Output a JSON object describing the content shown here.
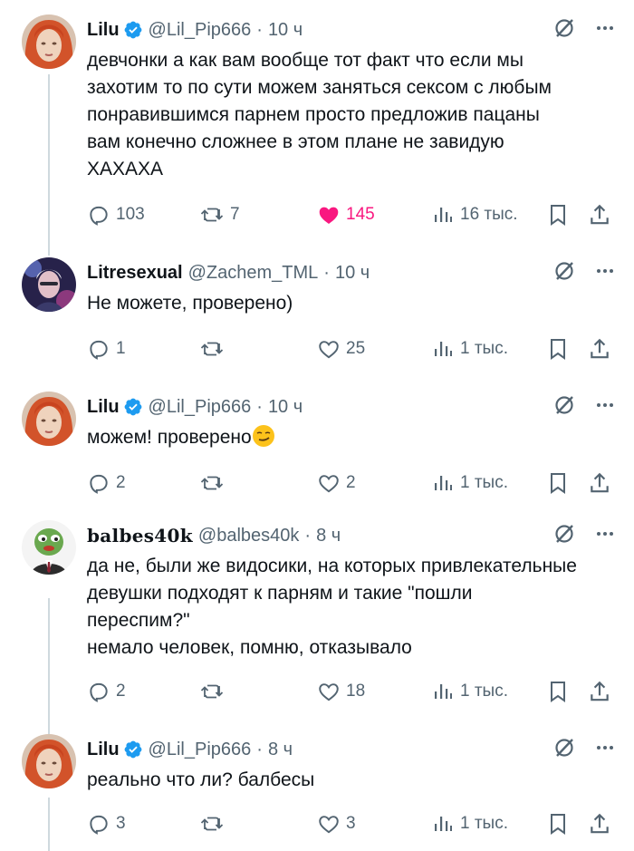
{
  "accent": {
    "like": "#f91880",
    "verified": "#1d9bf0",
    "muted": "#536471"
  },
  "posts": [
    {
      "name": "Lilu",
      "verified": true,
      "handle": "@Lil_Pip666",
      "time": "10 ч",
      "text": "девчонки а как вам вообще тот факт что если мы\nзахотим то по сути можем заняться сексом с любым\nпонравившимся парнем просто предложив пацаны\nвам конечно сложнее в этом плане не завидую\nХАХАХА",
      "replies": "103",
      "reposts": "7",
      "likes": "145",
      "views": "16 тыс."
    },
    {
      "name": "Litresexual",
      "verified": false,
      "handle": "@Zachem_TML",
      "time": "10 ч",
      "text": "Не можете, проверено)",
      "replies": "1",
      "reposts": "",
      "likes": "25",
      "views": "1 тыс."
    },
    {
      "name": "Lilu",
      "verified": true,
      "handle": "@Lil_Pip666",
      "time": "10 ч",
      "text": "можем! проверено",
      "replies": "2",
      "reposts": "",
      "likes": "2",
      "views": "1 тыс."
    },
    {
      "name": "balbes40k",
      "verified": false,
      "handle": "@balbes40k",
      "time": "8 ч",
      "text": "да не, были же видосики, на которых привлекательные\nдевушки подходят к парням и такие \"пошли\nпереспим?\"\nнемало человек, помню, отказывало",
      "replies": "2",
      "reposts": "",
      "likes": "18",
      "views": "1 тыс."
    },
    {
      "name": "Lilu",
      "verified": true,
      "handle": "@Lil_Pip666",
      "time": "8 ч",
      "text": "реально что ли? балбесы",
      "replies": "3",
      "reposts": "",
      "likes": "3",
      "views": "1 тыс."
    }
  ],
  "icons": [
    "verified-badge-icon",
    "grok-icon",
    "more-icon",
    "reply-icon",
    "repost-icon",
    "like-icon",
    "views-icon",
    "bookmark-icon",
    "share-icon",
    "smirk-emoji"
  ]
}
